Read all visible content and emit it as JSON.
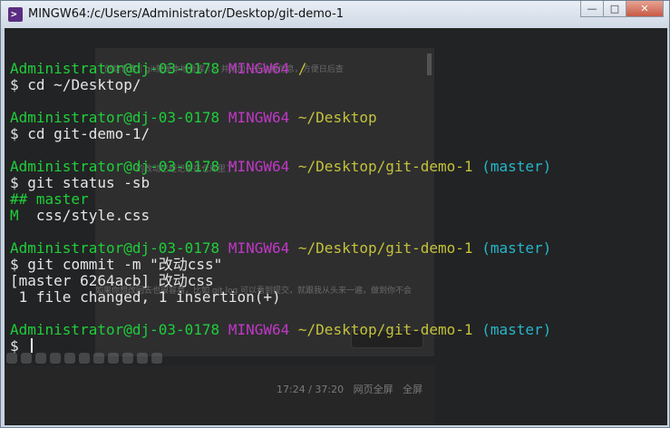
{
  "window": {
    "title": "MINGW64:/c/Users/Administrator/Desktop/git-demo-1",
    "minimize": "—",
    "maximize": "□",
    "close": "✕"
  },
  "background_overlay": {
    "hint1": "创建仓库｜git就是本地仓库｜，并添加一些注释信息，方便日后查",
    "hint2": "的改动已经记录在仓库里了。",
    "hint3": "如果你想改回去也很容易，比如 git log 可以看到提交，就跟我从头来一遍，做到你不会",
    "time": "17:24 / 37:20",
    "btn1": "网页全屏",
    "btn2": "全屏"
  },
  "terminal": {
    "user_host": "Administrator@dj-03-0178",
    "env": "MINGW64",
    "prompt_symbol": "$",
    "blocks": [
      {
        "path": "/",
        "branch": "",
        "command": "cd ~/Desktop/",
        "output": []
      },
      {
        "path": "~/Desktop",
        "branch": "",
        "command": "cd git-demo-1/",
        "output": []
      },
      {
        "path": "~/Desktop/git-demo-1",
        "branch": "(master)",
        "command": "git status -sb",
        "output": [
          {
            "text": "## master",
            "color": "green"
          },
          {
            "text": "M",
            "color": "green",
            "rest": "  css/style.css"
          }
        ]
      },
      {
        "path": "~/Desktop/git-demo-1",
        "branch": "(master)",
        "command": "git commit -m \"改动css\"",
        "output": [
          {
            "text": "[master 6264acb] 改动css",
            "color": "white"
          },
          {
            "text": " 1 file changed, 1 insertion(+)",
            "color": "white"
          }
        ]
      },
      {
        "path": "~/Desktop/git-demo-1",
        "branch": "(master)",
        "command": "",
        "output": []
      }
    ]
  }
}
